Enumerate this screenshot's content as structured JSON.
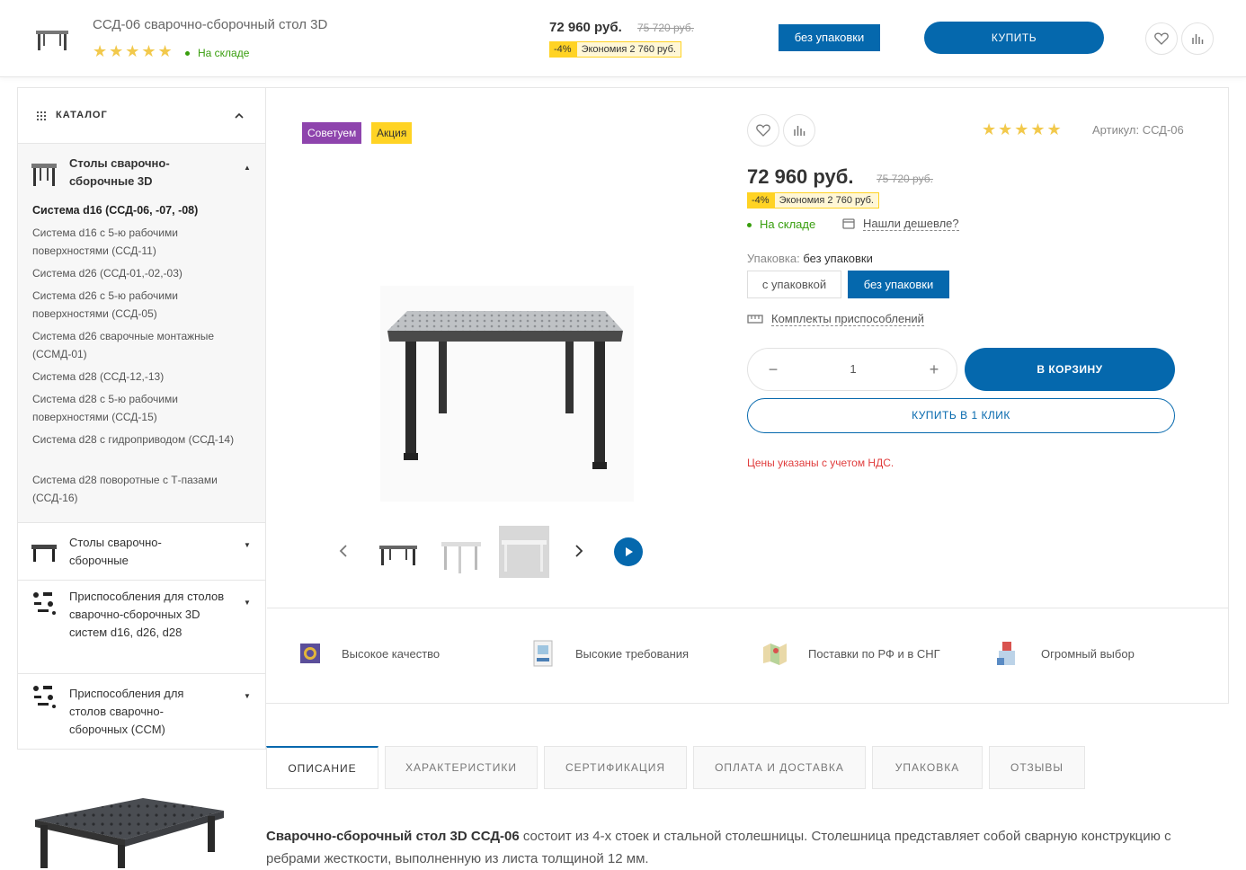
{
  "sticky": {
    "product_name": "ССД-06 сварочно-сборочный стол 3D",
    "stars": "★★★★★",
    "stock": "На складе",
    "price": "72 960 руб.",
    "old_price": "75 720 руб.",
    "discount": "-4%",
    "economy": "Экономия 2 760 руб.",
    "pack_button": "без упаковки",
    "buy_button": "КУПИТЬ"
  },
  "sidebar": {
    "title": "КАТАЛОГ",
    "open_category": "Столы сварочно-сборочные 3D",
    "subitems": [
      "Система d16 (ССД-06, -07, -08)",
      "Система d16 с 5-ю рабочими поверхностями (ССД-11)",
      "Система d26 (ССД-01,-02,-03)",
      "Система d26 с 5-ю рабочими поверхностями (ССД-05)",
      "Система d26 сварочные монтажные (ССМД-01)",
      "Система d28 (ССД-12,-13)",
      "Система d28 с 5-ю рабочими поверхностями (ССД-15)",
      "Система d28 с гидроприводом (ССД-14)",
      "Система d28 поворотные с Т-пазами (ССД-16)"
    ],
    "categories": [
      "Столы сварочно-сборочные",
      "Приспособления для столов сварочно-сборочных 3D систем d16, d26, d28",
      "Приспособления для столов сварочно-сборочных (ССМ)"
    ]
  },
  "product": {
    "badge_recommend": "Советуем",
    "badge_sale": "Акция",
    "stars": "★★★★★",
    "article": "Артикул: ССД-06",
    "price": "72 960 руб.",
    "old_price": "75 720 руб.",
    "discount": "-4%",
    "economy": "Экономия 2 760 руб.",
    "stock": "На складе",
    "cheaper": "Нашли дешевле?",
    "pack_label": "Упаковка:",
    "pack_value": "без упаковки",
    "pack_options": [
      "с упаковкой",
      "без упаковки"
    ],
    "kits_link": "Комплекты приспособлений",
    "quantity": "1",
    "cart_button": "В КОРЗИНУ",
    "one_click_button": "КУПИТЬ В 1 КЛИК",
    "vat_note": "Цены указаны с учетом НДС."
  },
  "features": [
    "Высокое качество",
    "Высокие требования",
    "Поставки по РФ и в СНГ",
    "Огромный выбор"
  ],
  "tabs": [
    "ОПИСАНИЕ",
    "ХАРАКТЕРИСТИКИ",
    "СЕРТИФИКАЦИЯ",
    "ОПЛАТА И ДОСТАВКА",
    "УПАКОВКА",
    "ОТЗЫВЫ"
  ],
  "description": {
    "bold": "Сварочно-сборочный стол 3D ССД-06",
    "text": " состоит из 4-х стоек и стальной столешницы. Столешница представляет собой сварную конструкцию с ребрами жесткости, выполненную из листа толщиной 12 мм."
  },
  "colors": {
    "accent": "#0568ad",
    "stars": "#f2c94c",
    "stock": "#389e0d",
    "badge_recommend": "#8e44ad",
    "badge_sale": "#ffd324",
    "vat": "#e03d3d"
  }
}
